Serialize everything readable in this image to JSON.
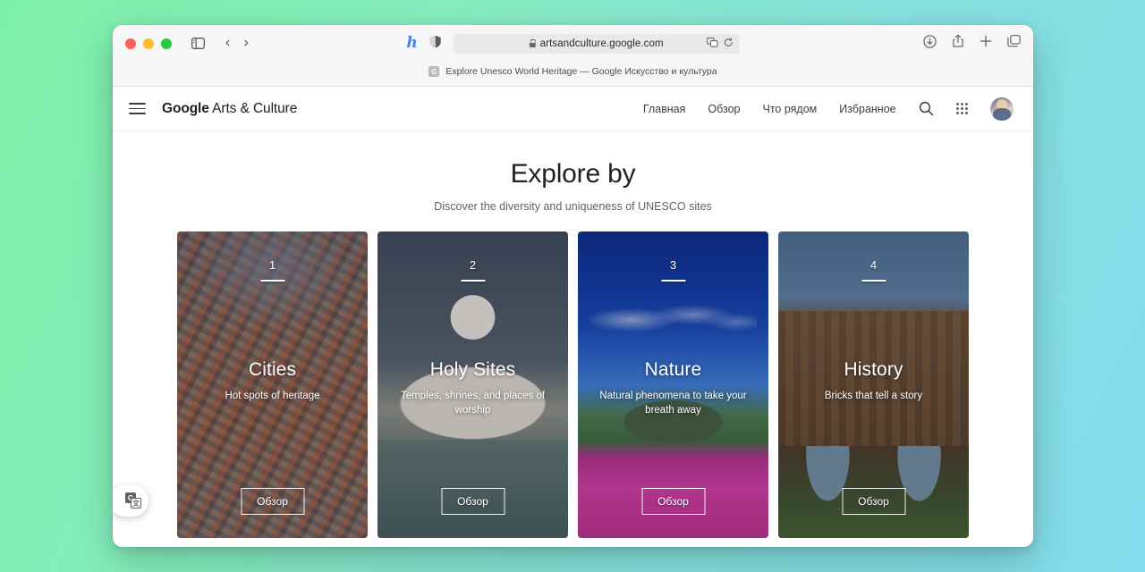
{
  "browser": {
    "traffic_lights": [
      "close",
      "minimize",
      "maximize"
    ],
    "extensions": [
      {
        "name": "honey-extension-icon",
        "glyph": "h"
      },
      {
        "name": "reader-shield-icon",
        "glyph": ""
      }
    ],
    "url": "artsandculture.google.com",
    "url_icons": [
      "translate-page-icon",
      "reload-icon"
    ],
    "toolbar_right_icons": [
      "downloads-icon",
      "share-icon",
      "new-tab-icon",
      "tab-overview-icon"
    ],
    "tab": {
      "favicon_letter": "G",
      "title": "Explore Unesco World Heritage — Google Искусство и культура"
    }
  },
  "site_nav": {
    "menu_label": "menu",
    "brand_bold": "Google",
    "brand_regular": " Arts & Culture",
    "links": [
      {
        "label": "Главная"
      },
      {
        "label": "Обзор"
      },
      {
        "label": "Что рядом"
      },
      {
        "label": "Избранное"
      }
    ],
    "search_icon": "search-icon",
    "apps_icon": "apps-grid-icon",
    "avatar": "user-avatar"
  },
  "hero": {
    "title": "Explore by",
    "subtitle": "Discover the diversity and uniqueness of UNESCO sites"
  },
  "cards": [
    {
      "number": "1",
      "title": "Cities",
      "subtitle": "Hot spots of heritage",
      "button": "Обзор",
      "image": "aerial-city-terracotta-roofs"
    },
    {
      "number": "2",
      "title": "Holy Sites",
      "subtitle": "Temples, shrines, and places of worship",
      "button": "Обзор",
      "image": "taj-mahal-at-dusk"
    },
    {
      "number": "3",
      "title": "Nature",
      "subtitle": "Natural phenomena to take your breath away",
      "button": "Обзор",
      "image": "mountain-with-magenta-flowers"
    },
    {
      "number": "4",
      "title": "History",
      "subtitle": "Bricks that tell a story",
      "button": "Обзор",
      "image": "stone-aqueduct-arches"
    }
  ],
  "translate_widget": {
    "icon": "translate-icon",
    "back_glyph": "G",
    "front_glyph": "文"
  },
  "colors": {
    "background_start": "#7df0a8",
    "background_end": "#84dbec",
    "brand_text": "#202124",
    "muted_text": "#5f6368",
    "extension_accent": "#4285f4"
  }
}
